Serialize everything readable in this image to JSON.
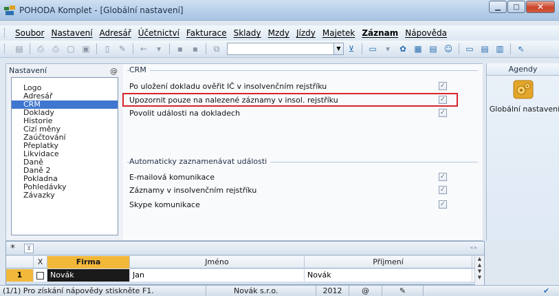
{
  "window": {
    "title": "POHODA Komplet - [Globální nastavení]",
    "controls": [
      "minimize",
      "maximize",
      "close"
    ]
  },
  "menu": {
    "items": [
      {
        "label": "Soubor"
      },
      {
        "label": "Nastavení"
      },
      {
        "label": "Adresář"
      },
      {
        "label": "Účetnictví"
      },
      {
        "label": "Fakturace"
      },
      {
        "label": "Sklady"
      },
      {
        "label": "Mzdy"
      },
      {
        "label": "Jízdy"
      },
      {
        "label": "Majetek"
      },
      {
        "label": "Záznam",
        "bold": true
      },
      {
        "label": "Nápověda"
      }
    ]
  },
  "settings": {
    "legend": "Nastavení",
    "at_symbol": "@",
    "items": [
      "Logo",
      "Adresář",
      "CRM",
      "Doklady",
      "Historie",
      "Cizí měny",
      "Zaúčtování",
      "Přeplatky",
      "Likvidace",
      "Daně",
      "Daně 2",
      "Pokladna",
      "Pohledávky",
      "Závazky"
    ],
    "selected": "CRM"
  },
  "crm": {
    "legend": "CRM",
    "options": [
      {
        "label": "Po uložení dokladu ověřit IČ v insolvenčním rejstříku",
        "checked": true
      },
      {
        "label": "Upozornit pouze na nalezené záznamy v insol. rejstříku",
        "checked": true,
        "highlighted": true
      },
      {
        "label": "Povolit události na dokladech",
        "checked": true
      }
    ],
    "auto_legend": "Automaticky zaznamenávat události",
    "auto_options": [
      {
        "label": "E-mailová komunikace",
        "checked": true
      },
      {
        "label": "Záznamy v insolvenčním rejstříku",
        "checked": true
      },
      {
        "label": "Skype komunikace",
        "checked": true
      }
    ],
    "check_mark": "✓"
  },
  "agendy": {
    "header": "Agendy",
    "item_label": "Globální nastavení"
  },
  "grid": {
    "star": "*",
    "columns": {
      "x": "X",
      "firma": "Firma",
      "jmeno": "Jméno",
      "prijmeni": "Příjmení"
    },
    "rows": [
      {
        "num": "1",
        "firma": "Novák",
        "jmeno": "Jan",
        "prijmeni": "Novák"
      }
    ]
  },
  "status": {
    "hint": "(1/1) Pro získání nápovědy stiskněte F1.",
    "company": "Novák s.r.o.",
    "year": "2012",
    "at": "@"
  },
  "colors": {
    "selected": "#3f76cf",
    "highlight": "#d8242a",
    "grid_accent": "#f2b83a"
  }
}
